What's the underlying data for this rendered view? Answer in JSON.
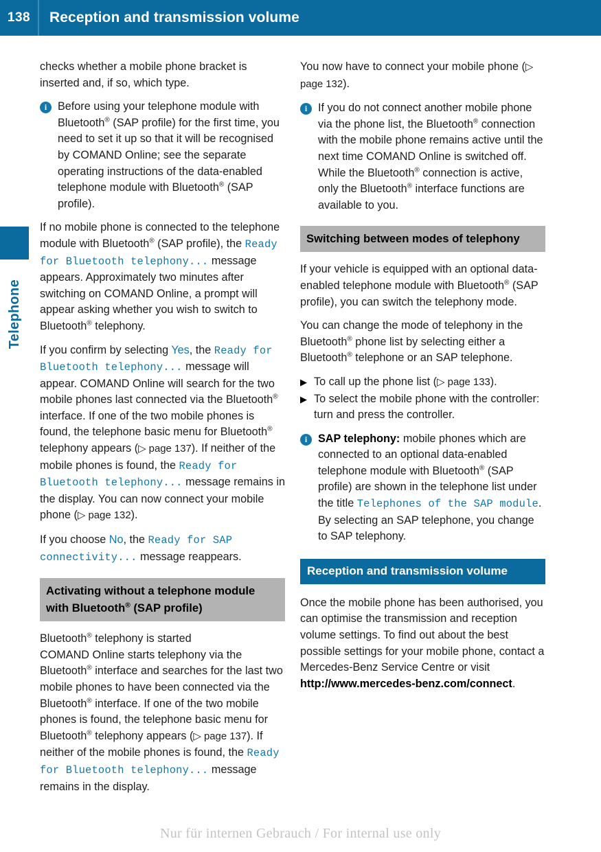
{
  "header": {
    "page_number": "138",
    "title": "Reception and transmission volume"
  },
  "side_tab": {
    "label": "Telephone"
  },
  "left_column": {
    "para_continued": "checks whether a mobile phone bracket is inserted and, if so, which type.",
    "note_1": {
      "icon": "info-icon",
      "text_a": "Before using your telephone module with Bluetooth",
      "reg_1": "®",
      "text_b": " (SAP profile) for the first time, you need to set it up so that it will be recognised by COMAND Online; see the separate operating instructions of the data-enabled telephone module with Bluetooth",
      "reg_2": "®",
      "text_c": " (SAP profile)."
    },
    "para_2": {
      "a": "If no mobile phone is connected to the telephone module with Bluetooth",
      "reg": "®",
      "b": " (SAP profile), the ",
      "mono": "Ready for Bluetooth telephony...",
      "c": " message appears. Approximately two minutes after switching on COMAND Online, a prompt will appear asking whether you wish to switch to Bluetooth",
      "reg2": "®",
      "d": " telephony."
    },
    "para_3": {
      "a": "If you confirm by selecting ",
      "ui_yes": "Yes",
      "b": ", the ",
      "mono": "Ready for Bluetooth telephony...",
      "c": " message will appear. COMAND Online will search for the two mobile phones last connected via the Bluetooth",
      "reg": "®",
      "d": " interface. If one of the two mobile phones is found, the telephone basic menu for Bluetooth",
      "reg2": "®",
      "e": " telephony appears (",
      "pageref_1": "▷ page 137",
      "f": "). If neither of the mobile phones is found, the ",
      "mono2": "Ready for Bluetooth telephony...",
      "g": " message remains in the display. You can now connect your mobile phone (",
      "pageref_2": "▷ page 132",
      "h": ")."
    },
    "para_4": {
      "a": "If you choose ",
      "ui_no": "No",
      "b": ", the ",
      "mono": "Ready for SAP connectivity...",
      "c": " message reappears."
    },
    "sub_heading": {
      "a": "Activating without a telephone module with Bluetooth",
      "reg": "®",
      "b": " (SAP profile)"
    },
    "para_5": {
      "a": "Bluetooth",
      "reg": "®",
      "b": " telephony is started"
    },
    "para_6": {
      "a": "COMAND Online starts telephony via the Bluetooth",
      "reg": "®",
      "b": " interface and searches for the last two mobile phones to have been connected via the Bluetooth",
      "reg2": "®",
      "c": " interface. If one of the two mobile phones is found, the telephone basic menu for Bluetooth",
      "reg3": "®",
      "d": " telephony appears (",
      "pageref": "▷ page 137",
      "e": "). If neither of the mobile phones is found, the ",
      "mono": "Ready for Bluetooth telephony...",
      "f": " message remains in the display."
    }
  },
  "right_column": {
    "para_1": {
      "a": "You now have to connect your mobile phone (",
      "pageref": "▷ page 132",
      "b": ")."
    },
    "note_1": {
      "icon": "info-icon",
      "a": "If you do not connect another mobile phone via the phone list, the Bluetooth",
      "reg": "®",
      "b": " connection with the mobile phone remains active until the next time COMAND Online is switched off. While the Bluetooth",
      "reg2": "®",
      "c": " connection is active, only the Bluetooth",
      "reg3": "®",
      "d": " interface functions are available to you."
    },
    "sub_heading": "Switching between modes of telephony",
    "para_2": {
      "a": "If your vehicle is equipped with an optional data-enabled telephone module with Bluetooth",
      "reg": "®",
      "b": " (SAP profile), you can switch the telephony mode."
    },
    "para_3": {
      "a": "You can change the mode of telephony in the Bluetooth",
      "reg": "®",
      "b": " phone list by selecting either a Bluetooth",
      "reg2": "®",
      "c": " telephone or an SAP telephone."
    },
    "bullets": [
      {
        "marker": "▶",
        "a": "To call up the phone list (",
        "pageref": "▷ page 133",
        "b": ")."
      },
      {
        "marker": "▶",
        "a": "To select the mobile phone with the controller: turn and press the controller.",
        "pageref": "",
        "b": ""
      }
    ],
    "note_2": {
      "icon": "info-icon",
      "bold_lead": "SAP telephony:",
      "a": " mobile phones which are connected to an optional data-enabled telephone module with Bluetooth",
      "reg": "®",
      "b": " (SAP profile) are shown in the telephone list under the title ",
      "mono": "Telephones of the SAP module",
      "c": ". By selecting an SAP telephone, you change to SAP telephony."
    },
    "main_heading": "Reception and transmission volume",
    "para_4": {
      "a": "Once the mobile phone has been authorised, you can optimise the transmission and reception volume settings. To find out about the best possible settings for your mobile phone, contact a Mercedes-Benz Service Centre or visit ",
      "url": "http://www.mercedes-benz.com/connect",
      "b": "."
    }
  },
  "footer": {
    "watermark": "Nur für internen Gebrauch / For internal use only"
  },
  "colors": {
    "header_blue": "#0b6b9e",
    "ui_text_blue": "#1277ab",
    "subhead_gray": "#b3b3b3",
    "body_text": "#1d1d1b"
  }
}
